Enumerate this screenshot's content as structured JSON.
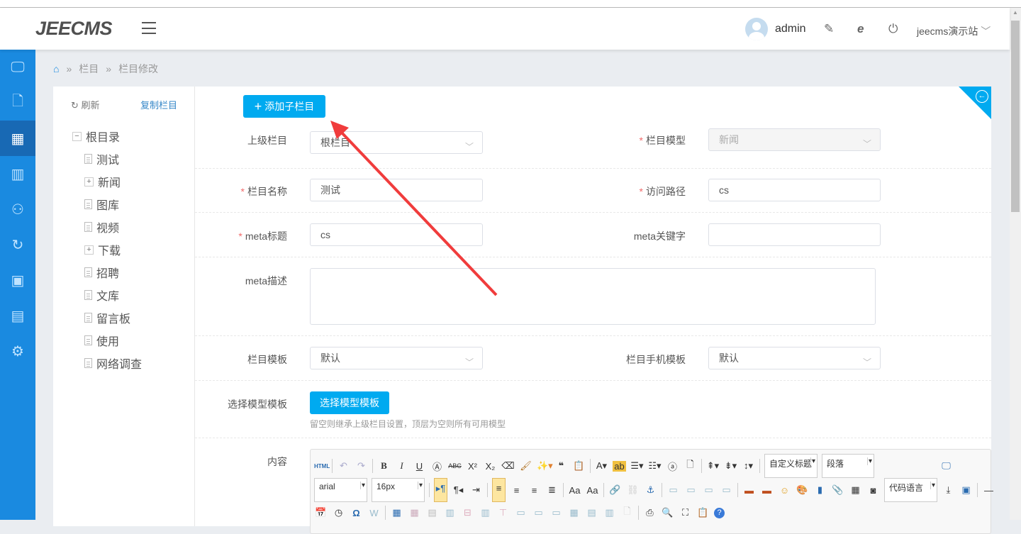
{
  "header": {
    "logo": "JEECMS",
    "username": "admin",
    "site": "jeecms演示站"
  },
  "sidebar": [
    "monitor-icon",
    "file-icon",
    "grid-icon",
    "chart-icon",
    "user-icon",
    "sync-icon",
    "box-icon",
    "layout-icon",
    "gear-icon"
  ],
  "breadcrumb": [
    "栏目",
    "栏目修改"
  ],
  "tree": {
    "refresh": "刷新",
    "copy": "复制栏目",
    "root": "根目录",
    "items": [
      {
        "label": "测试",
        "expandable": false
      },
      {
        "label": "新闻",
        "expandable": true
      },
      {
        "label": "图库",
        "expandable": false
      },
      {
        "label": "视频",
        "expandable": false
      },
      {
        "label": "下载",
        "expandable": true
      },
      {
        "label": "招聘",
        "expandable": false
      },
      {
        "label": "文库",
        "expandable": false
      },
      {
        "label": "留言板",
        "expandable": false
      },
      {
        "label": "使用",
        "expandable": false
      },
      {
        "label": "网络调查",
        "expandable": false
      }
    ]
  },
  "form": {
    "add_child": "添加子栏目",
    "parent_label": "上级栏目",
    "parent_value": "根栏目",
    "model_label": "栏目模型",
    "model_value": "新闻",
    "name_label": "栏目名称",
    "name_value": "测试",
    "path_label": "访问路径",
    "path_value": "cs",
    "meta_title_label": "meta标题",
    "meta_title_value": "cs",
    "meta_kw_label": "meta关键字",
    "meta_kw_value": "",
    "meta_desc_label": "meta描述",
    "meta_desc_value": "",
    "tpl_label": "栏目模板",
    "tpl_value": "默认",
    "mtpl_label": "栏目手机模板",
    "mtpl_value": "默认",
    "model_tpl_label": "选择模型模板",
    "model_tpl_button": "选择模型模板",
    "model_tpl_hint": "留空则继承上级栏目设置，顶层为空则所有可用模型",
    "content_label": "内容",
    "required": "*"
  },
  "editor": {
    "html": "HTML",
    "custom_heading": "自定义标题",
    "paragraph": "段落",
    "font": "arial",
    "size": "16px",
    "code_lang": "代码语言"
  },
  "colors": {
    "accent": "#00aaf0",
    "sidebar": "#1a8ae0",
    "annotation_arrow": "#f03c3c"
  }
}
